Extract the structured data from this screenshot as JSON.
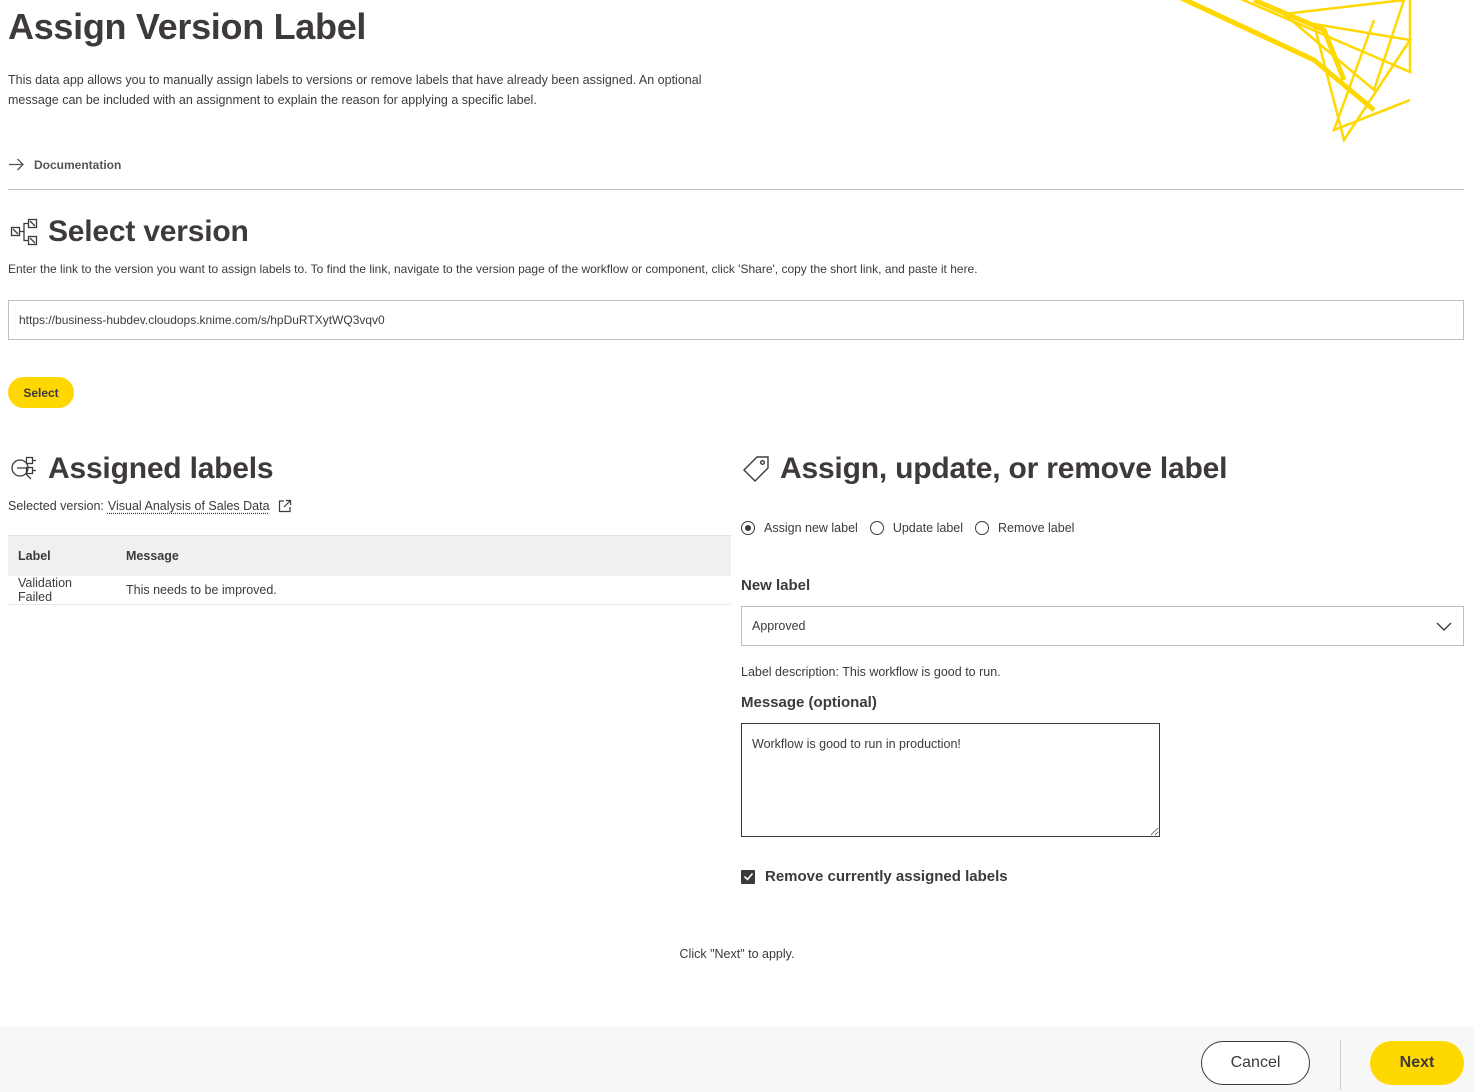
{
  "page": {
    "title": "Assign Version Label",
    "intro": "This data app allows you to manually assign labels to versions or remove labels that have already been assigned. An optional message can be included with an assignment to explain the reason for applying a specific label.",
    "documentation_link": "Documentation"
  },
  "select_version": {
    "heading": "Select version",
    "description": "Enter the link to the version you want to assign labels to. To find the link, navigate to the version page of the workflow or component, click 'Share', copy the short link, and paste it here.",
    "url_value": "https://business-hubdev.cloudops.knime.com/s/hpDuRTXytWQ3vqv0",
    "select_button": "Select"
  },
  "assigned_labels": {
    "heading": "Assigned labels",
    "selected_version_prefix": "Selected version:",
    "selected_version_name": "Visual Analysis of Sales Data",
    "columns": [
      "Label",
      "Message"
    ],
    "rows": [
      [
        "Validation Failed",
        "This needs to be improved."
      ]
    ]
  },
  "assign_form": {
    "heading": "Assign, update, or remove label",
    "radio_options": [
      "Assign new label",
      "Update label",
      "Remove label"
    ],
    "selected_option": "Assign new label",
    "new_label_heading": "New label",
    "new_label_value": "Approved",
    "label_description": "Label description: This workflow is good to run.",
    "message_heading": "Message (optional)",
    "message_value": "Workflow is good to run in production!",
    "remove_checkbox_label": "Remove currently assigned labels",
    "remove_checkbox_checked": true
  },
  "hint": "Click \"Next\" to apply.",
  "footer": {
    "cancel": "Cancel",
    "next": "Next"
  },
  "colors": {
    "accent": "#ffd800",
    "text": "#3e3a39",
    "footer_bg": "#f7f7f7"
  }
}
